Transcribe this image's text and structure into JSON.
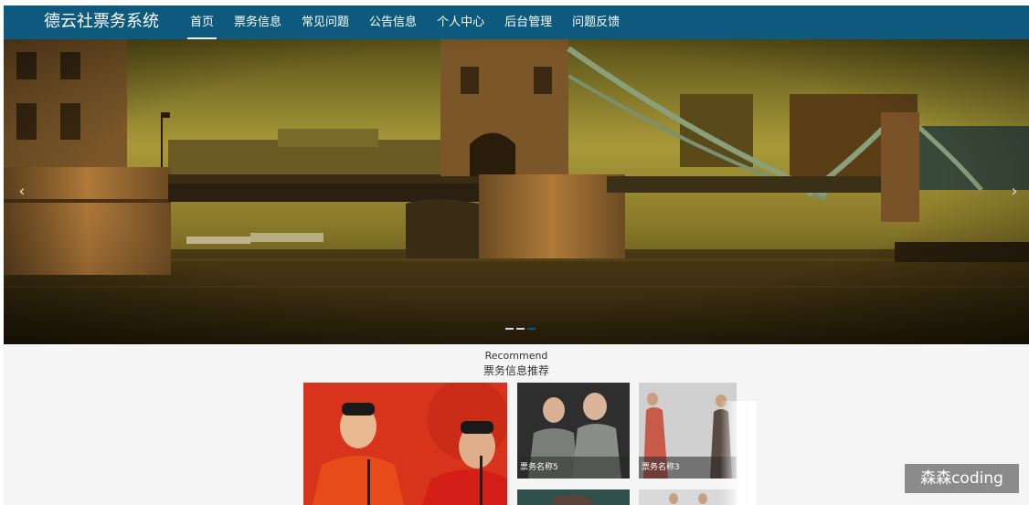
{
  "brand": {
    "title": "德云社票务系统"
  },
  "nav": {
    "items": [
      {
        "label": "首页",
        "active": true
      },
      {
        "label": "票务信息",
        "active": false
      },
      {
        "label": "常见问题",
        "active": false
      },
      {
        "label": "公告信息",
        "active": false
      },
      {
        "label": "个人中心",
        "active": false
      },
      {
        "label": "后台管理",
        "active": false
      },
      {
        "label": "问题反馈",
        "active": false
      }
    ]
  },
  "carousel": {
    "prev_icon": "chevron-left-icon",
    "next_icon": "chevron-right-icon",
    "prev_glyph": "‹",
    "next_glyph": "›",
    "slide_count": 3,
    "active_index": 2
  },
  "recommend": {
    "title_en": "Recommend",
    "title_cn": "票务信息推荐",
    "cards": [
      {
        "caption": ""
      },
      {
        "caption": "票务名称5"
      },
      {
        "caption": "票务名称3"
      },
      {
        "caption": ""
      },
      {
        "caption": ""
      }
    ]
  },
  "watermark": {
    "text": "森森coding"
  },
  "colors": {
    "nav_bg": "#0d5a7e",
    "indicator_active": "#0d5a7e",
    "section_bg": "#f5f5f5"
  }
}
